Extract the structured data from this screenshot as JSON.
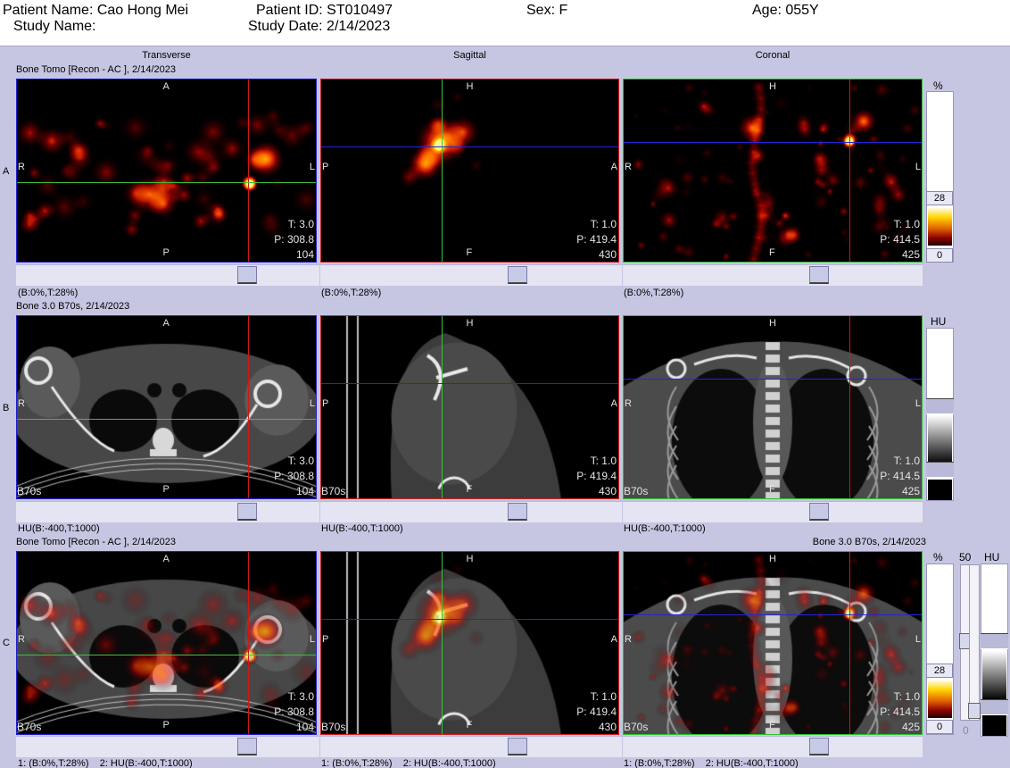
{
  "header": {
    "patient_name": "Patient Name: Cao Hong Mei",
    "study_name": "Study Name:",
    "patient_id": "Patient ID: ST010497",
    "study_date": "Study Date: 2/14/2023",
    "sex": "Sex: F",
    "age": "Age: 055Y"
  },
  "columns": {
    "transverse": "Transverse",
    "sagittal": "Sagittal",
    "coronal": "Coronal"
  },
  "rows": {
    "a": {
      "letter": "A",
      "series": "Bone Tomo [Recon - AC ], 2/14/2023",
      "window": "(B:0%,T:28%)"
    },
    "b": {
      "letter": "B",
      "series": "Bone  3.0  B70s, 2/14/2023",
      "window": "HU(B:-400,T:1000)"
    },
    "c": {
      "letter": "C",
      "series_left": "Bone Tomo [Recon - AC ], 2/14/2023",
      "series_right": "Bone  3.0  B70s, 2/14/2023",
      "window": "1: (B:0%,T:28%)    2: HU(B:-400,T:1000)"
    }
  },
  "orient": {
    "transverse": {
      "top": "A",
      "bottom": "P",
      "left": "R",
      "right": "L"
    },
    "sagittal": {
      "top": "H",
      "bottom": "F",
      "left": "P",
      "right": "A"
    },
    "coronal": {
      "top": "H",
      "bottom": "F",
      "left": "R",
      "right": "L"
    }
  },
  "slice_info": {
    "transverse": {
      "t": "T: 3.0",
      "p": "P: 308.8",
      "n": "104"
    },
    "sagittal": {
      "t": "T: 1.0",
      "p": "P: 419.4",
      "n": "430"
    },
    "coronal": {
      "t": "T: 1.0",
      "p": "P: 414.5",
      "n": "425"
    }
  },
  "ct_kernel": "B70s",
  "colorbars": {
    "pct_label": "%",
    "hu_label": "HU",
    "top_value": "28",
    "bottom_value": "0",
    "blend_value": "50",
    "blend_min": "0"
  },
  "colors": {
    "transverse_frame": "#2020d0",
    "sagittal_frame": "#d02020",
    "coronal_frame": "#30c030",
    "crosshair_red": "#d01818",
    "crosshair_green": "#3cc03c",
    "crosshair_blue": "#2424d8"
  }
}
